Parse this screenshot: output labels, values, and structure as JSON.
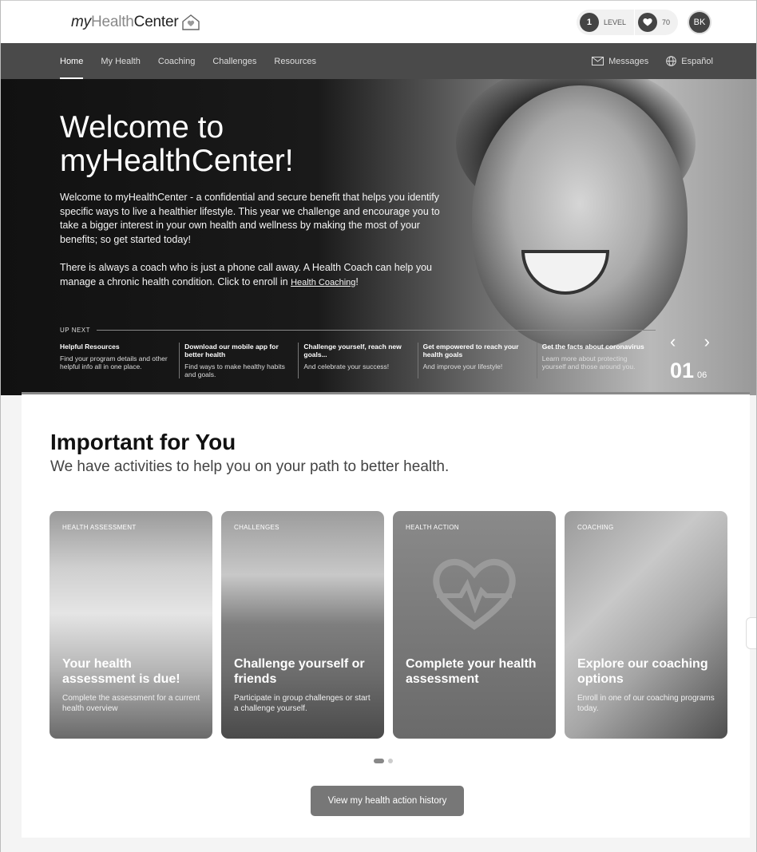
{
  "header": {
    "logo": {
      "my": "my",
      "health": "Health",
      "center": "Center"
    },
    "level": {
      "value": "1",
      "label": "LEVEL"
    },
    "hearts": {
      "value": "70"
    },
    "user_initials": "BK"
  },
  "nav": {
    "items": [
      {
        "label": "Home",
        "active": true
      },
      {
        "label": "My Health"
      },
      {
        "label": "Coaching"
      },
      {
        "label": "Challenges"
      },
      {
        "label": "Resources"
      }
    ],
    "messages_label": "Messages",
    "language_label": "Español"
  },
  "hero": {
    "title_line1": "Welcome to",
    "title_line2": "myHealthCenter!",
    "paragraph1": "Welcome to myHealthCenter - a confidential and secure benefit that helps you identify specific ways to live a healthier lifestyle. This year we challenge and encourage you to take a bigger interest in your own health and wellness by making the most of your benefits; so get started today!",
    "paragraph2": "There is always a coach who is just a phone call away. A Health Coach can help you manage a chronic health condition. Click to enroll in ",
    "link_label": "Health Coaching",
    "paragraph2_end": "!",
    "up_next_label": "UP NEXT",
    "up_next": [
      {
        "title": "Helpful Resources",
        "desc": "Find your program details and other helpful info all in one place."
      },
      {
        "title": "Download our mobile app for better health",
        "desc": "Find ways to make healthy habits and goals."
      },
      {
        "title": "Challenge yourself, reach new goals...",
        "desc": "And celebrate your success!"
      },
      {
        "title": "Get empowered to reach your health goals",
        "desc": "And improve your lifestyle!"
      },
      {
        "title": "Get the facts about coronavirus",
        "desc": "Learn more about protecting yourself and those around you."
      }
    ],
    "counter_current": "01",
    "counter_total": "06"
  },
  "important": {
    "title": "Important for You",
    "subtitle": "We have activities to help you on your path to better health.",
    "cards": [
      {
        "category": "HEALTH ASSESSMENT",
        "title": "Your health assessment is due!",
        "desc": "Complete the assessment for a current health overview"
      },
      {
        "category": "CHALLENGES",
        "title": "Challenge yourself or friends",
        "desc": "Participate in group challenges or start a challenge yourself."
      },
      {
        "category": "HEALTH ACTION",
        "title": "Complete your health assessment",
        "desc": ""
      },
      {
        "category": "COACHING",
        "title": "Explore our coaching options",
        "desc": "Enroll in one of our coaching programs today."
      }
    ],
    "history_button": "View my health action history"
  }
}
